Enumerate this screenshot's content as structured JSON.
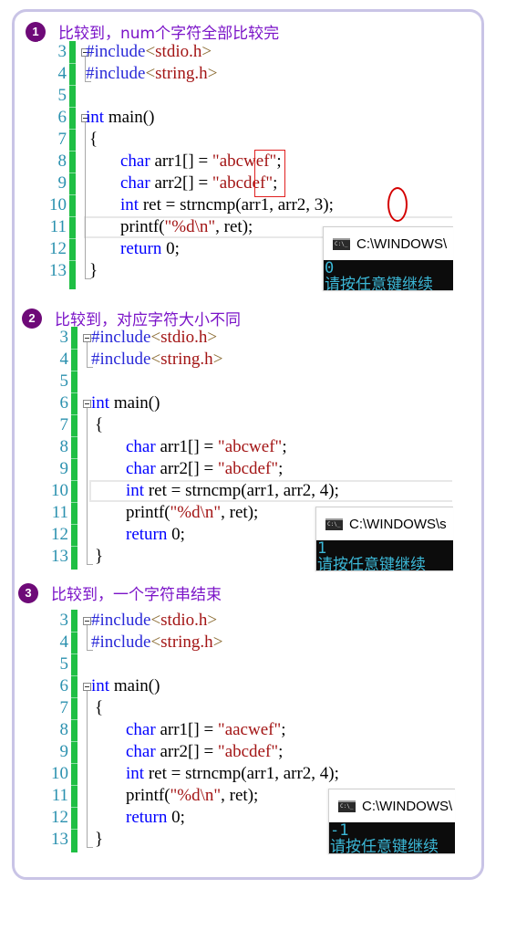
{
  "accent": {
    "title_color": "#7b14c8",
    "badge_color": "#6e0a78",
    "gutter_green": "#1fbf44",
    "frame_color": "#c9c4e6"
  },
  "sections": [
    {
      "badge": "1",
      "title": "比较到，num个字符全部比较完",
      "lines": [
        {
          "n": "3",
          "code": "#include<stdio.h>"
        },
        {
          "n": "4",
          "code": "#include<string.h>"
        },
        {
          "n": "5",
          "code": ""
        },
        {
          "n": "6",
          "code": "int main()"
        },
        {
          "n": "7",
          "code": "{"
        },
        {
          "n": "8",
          "code": "char arr1[] = \"abcwef\";"
        },
        {
          "n": "9",
          "code": "char arr2[] = \"abcdef\";"
        },
        {
          "n": "10",
          "code": "int ret = strncmp(arr1, arr2, 3);"
        },
        {
          "n": "11",
          "code": "printf(\"%d\\n\", ret);"
        },
        {
          "n": "12",
          "code": "return 0;"
        },
        {
          "n": "13",
          "code": "}"
        }
      ],
      "arr1": "abcwef",
      "arr2": "abcdef",
      "num": "3",
      "console": {
        "title": "C:\\WINDOWS\\",
        "output": "0",
        "prompt": "请按任意键继续"
      }
    },
    {
      "badge": "2",
      "title": "比较到，对应字符大小不同",
      "arr1": "abcwef",
      "arr2": "abcdef",
      "num": "4",
      "console": {
        "title": "C:\\WINDOWS\\s",
        "output": "1",
        "prompt": "请按任意键继续"
      }
    },
    {
      "badge": "3",
      "title": "比较到，一个字符串结束",
      "arr1": "aacwef",
      "arr2": "abcdef",
      "num": "4",
      "console": {
        "title": "C:\\WINDOWS\\",
        "output": "-1",
        "prompt": "请按任意键继续"
      }
    }
  ],
  "code": {
    "include1_kw": "#include",
    "include1_hdr": "stdio.h",
    "include2_kw": "#include",
    "include2_hdr": "string.h",
    "lt": "<",
    "gt": ">",
    "int_kw": "int",
    "main_sig": " main()",
    "open_brace": "{",
    "close_brace": "}",
    "char_kw": "char",
    "arr1_decl": " arr1[] = ",
    "arr2_decl": " arr2[] = ",
    "quote": "\"",
    "semi": ";",
    "ret_decl": " ret = strncmp(arr1, arr2, ",
    "ret_close": ");",
    "printf_open": "printf(",
    "fmt": "\"%d\\n\"",
    "printf_rest": ", ret);",
    "return_kw": "return",
    "return_rest": " 0;",
    "line_numbers": [
      "3",
      "4",
      "5",
      "6",
      "7",
      "8",
      "9",
      "10",
      "11",
      "12",
      "13"
    ]
  }
}
